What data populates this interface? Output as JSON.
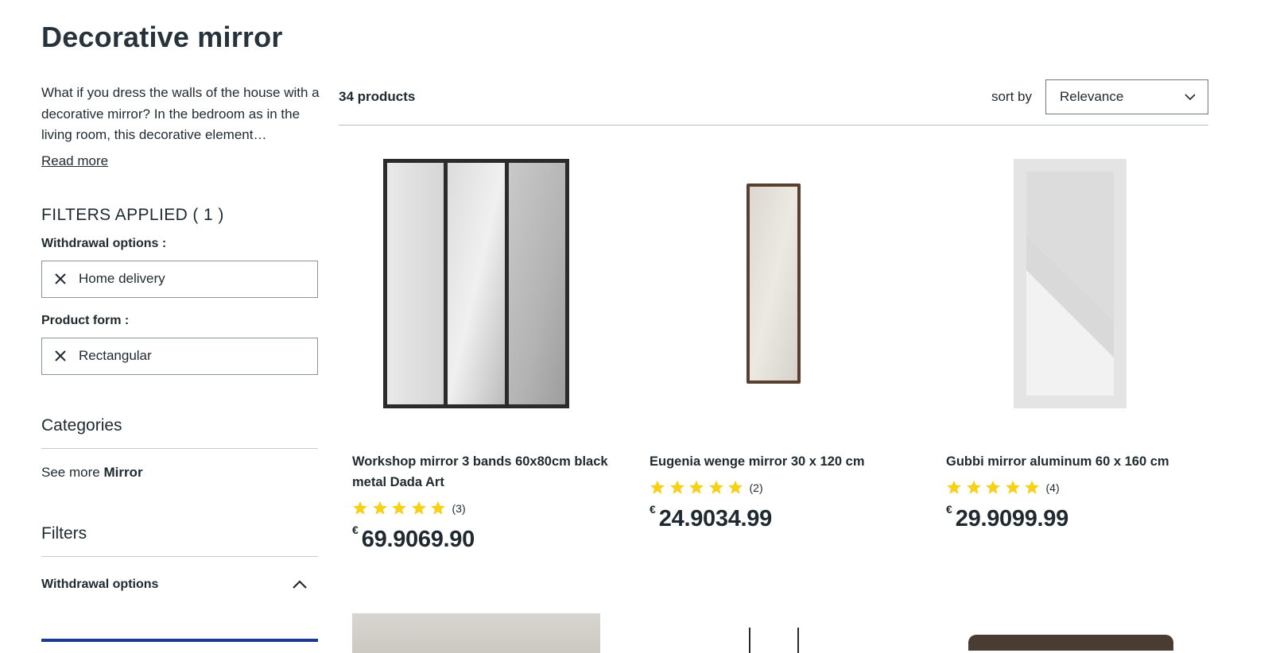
{
  "page": {
    "title": "Decorative mirror",
    "description": "What if you dress the walls of the house with a decorative mirror? In the bedroom as in the living room, this decorative element…",
    "read_more": "Read more"
  },
  "sidebar": {
    "filters_applied_title": "FILTERS APPLIED ( 1 )",
    "applied_groups": [
      {
        "label": "Withdrawal options :",
        "value": "Home delivery"
      },
      {
        "label": "Product form :",
        "value": "Rectangular"
      }
    ],
    "categories_title": "Categories",
    "see_more_prefix": "See more",
    "see_more_category": "Mirror",
    "filters_title": "Filters",
    "accordion_label": "Withdrawal options"
  },
  "toolbar": {
    "count": "34 products",
    "sort_label": "sort by",
    "sort_value": "Relevance"
  },
  "products": [
    {
      "name": "Workshop mirror 3 bands 60x80cm black metal Dada Art",
      "rating": 5,
      "reviews": "(3)",
      "currency": "€",
      "price": "69.9069.90"
    },
    {
      "name": "Eugenia wenge mirror 30 x 120 cm",
      "rating": 5,
      "reviews": "(2)",
      "currency": "€",
      "price": "24.9034.99"
    },
    {
      "name": "Gubbi mirror aluminum 60 x 160 cm",
      "rating": 5,
      "reviews": "(4)",
      "currency": "€",
      "price": "29.9099.99"
    }
  ],
  "colors": {
    "star": "#f7d117",
    "text": "#1f2a30",
    "accent_blue": "#1a3a8f"
  },
  "icons": {
    "remove_filter": "close-icon",
    "sort_chevron": "chevron-down-icon",
    "accordion_chevron": "chevron-up-icon",
    "rating": "star-icon"
  }
}
